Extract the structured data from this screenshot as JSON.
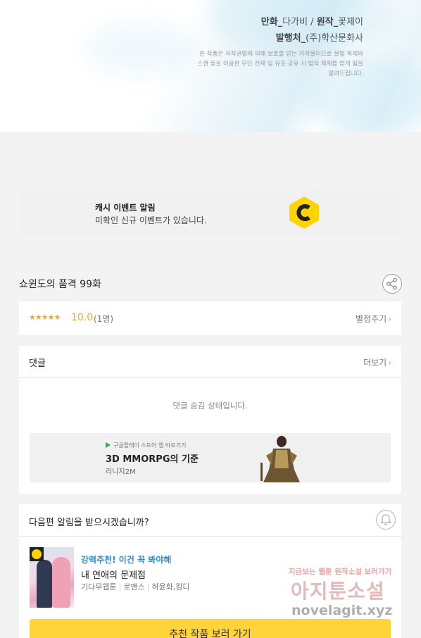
{
  "header": {
    "credit_line1_role": "만화_",
    "credit_line1_text": "다가비 / ",
    "credit_line1_role2": "원작_",
    "credit_line1_text2": "꽃제이",
    "credit_line2_role": "발행처_",
    "credit_line2_text": "(주)학산문화사",
    "copyright": "본 작품은 저작권법에 의해 보호를 받는 저작물이므로 불법 복제와 스캔 등을 이용한 무단 전재 및 유포·공유 시 법적 제재를 받게 됨을 알려드립니다."
  },
  "event_banner": {
    "title": "캐시 이벤트 알림",
    "subtitle": "미확인 신규 이벤트가 있습니다.",
    "icon": "cash-c-icon",
    "icon_color": "#FFD400"
  },
  "episode": {
    "title": "쇼윈도의 품격 99화"
  },
  "rating": {
    "stars": "★★★★★",
    "score": "10.0",
    "votes": "(1명)",
    "rate_link": "별점주기",
    "star_color": "#F5A623"
  },
  "comments": {
    "label": "댓글",
    "more_link": "더보기",
    "hidden_message": "댓글 숨김 상태입니다."
  },
  "ad": {
    "store_line": "구글플레이 스토어 앱 바로가기",
    "headline": "3D MMORPG의 기준",
    "game": "리니지2M"
  },
  "notify": {
    "question": "다음편 알림을 받으시겠습니까?",
    "rec_tag": "강력추천! 이건 꼭 봐야해",
    "rec_title": "내 연애의 문제점",
    "rec_meta": [
      "기다무웹툰",
      "로맨스",
      "허윤화,킹디"
    ],
    "cta_label": "추천 작품 보러 가기",
    "cta_color": "#FFD43B"
  },
  "watermark": {
    "line1": "지금보는 웹툰 원작소설 보러가기",
    "line2": "아지툰소설",
    "line3": "novelagit.xyz"
  }
}
